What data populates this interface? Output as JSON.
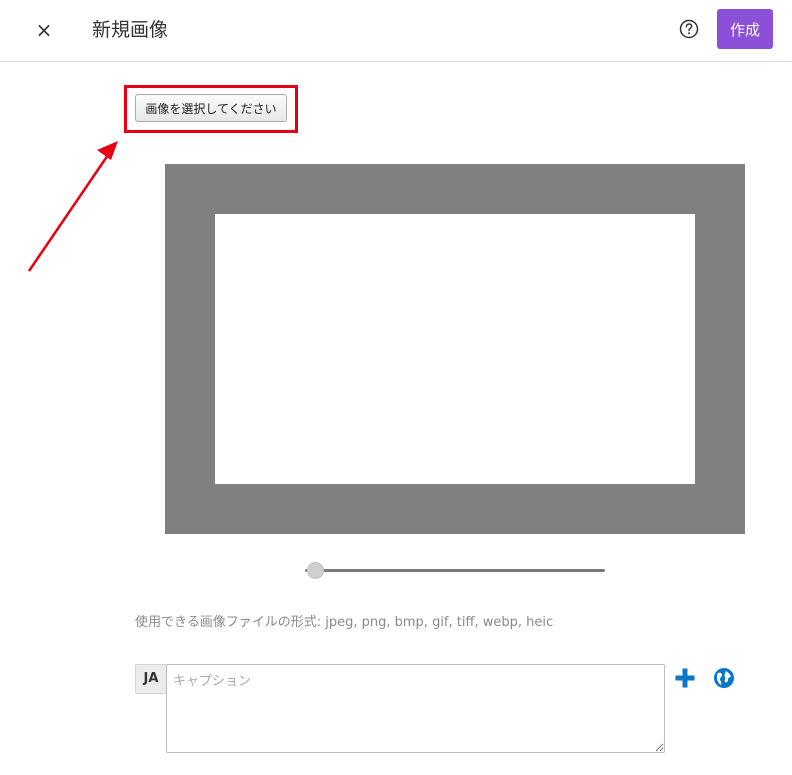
{
  "header": {
    "close_glyph": "×",
    "title": "新規画像",
    "create_label": "作成"
  },
  "image_picker": {
    "select_label": "画像を選択してください"
  },
  "zoom": {
    "level": 0
  },
  "formats_note": "使用できる画像ファイルの形式: jpeg, png, bmp, gif, tiff, webp, heic",
  "caption": {
    "language": "JA",
    "placeholder": "キャプション",
    "value": ""
  },
  "icons": {
    "help": "help-circle-icon",
    "add": "plus-icon",
    "language": "globe-icon"
  },
  "colors": {
    "accent": "#8b4fd8",
    "highlight": "#e60012",
    "icon_blue": "#0a77c9",
    "canvas_frame": "#808080"
  }
}
